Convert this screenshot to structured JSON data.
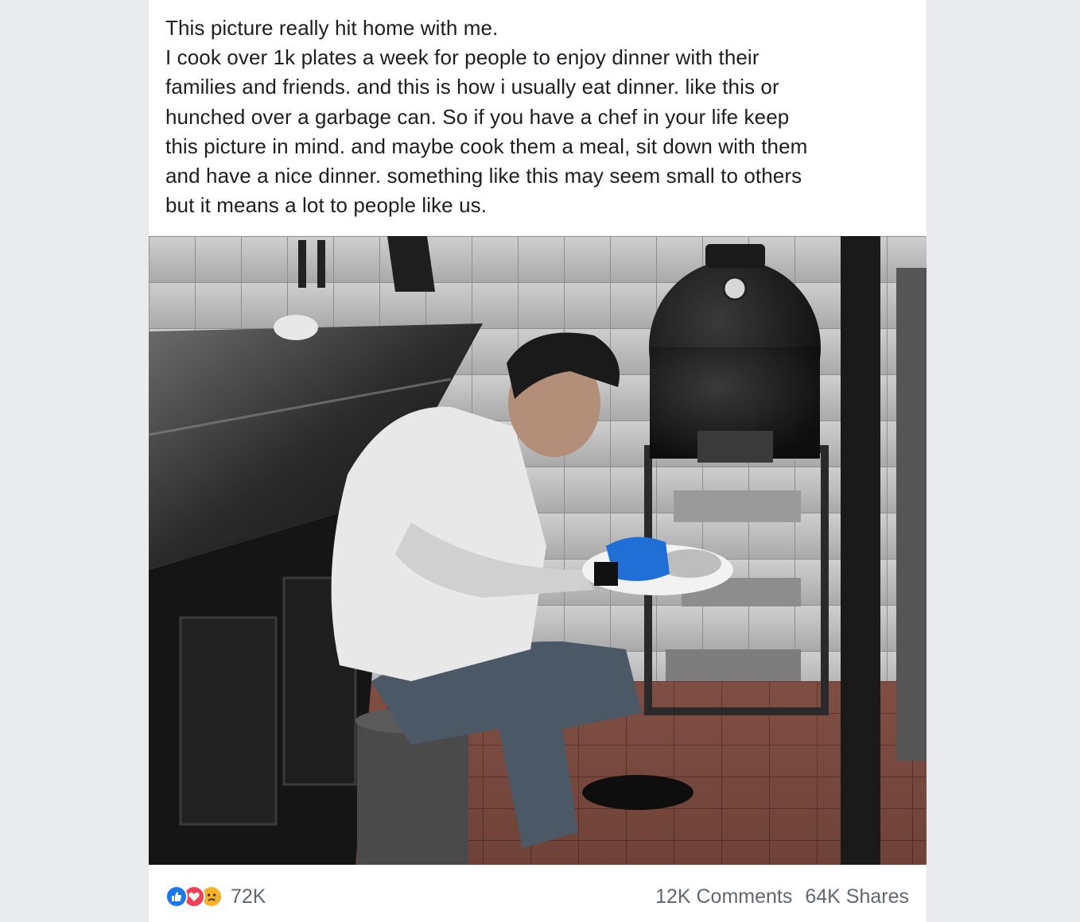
{
  "post": {
    "text_lines": [
      "This picture really hit home with me.",
      "I cook over 1k plates a week for people to enjoy dinner with their",
      "families and friends. and this is how i usually eat dinner. like this or",
      "hunched over a garbage can. So if you have a chef in your life keep",
      "this picture in mind. and maybe cook them a meal, sit down with them",
      "and have a nice dinner. something like this may seem small to others",
      "but it means a lot to people like us."
    ]
  },
  "photo": {
    "icon": "photo-chef-eating-in-kitchen"
  },
  "footer": {
    "reactions": {
      "icons": [
        "like-icon",
        "love-icon",
        "sad-icon"
      ],
      "count": "72K"
    },
    "comments": "12K Comments",
    "shares": "64K Shares"
  },
  "colors": {
    "like": "#1877f2",
    "love": "#f33e58",
    "sad": "#f7b125",
    "text": "#1c1e21",
    "secondary_text": "#606770",
    "page_background": "#e9ebee"
  }
}
